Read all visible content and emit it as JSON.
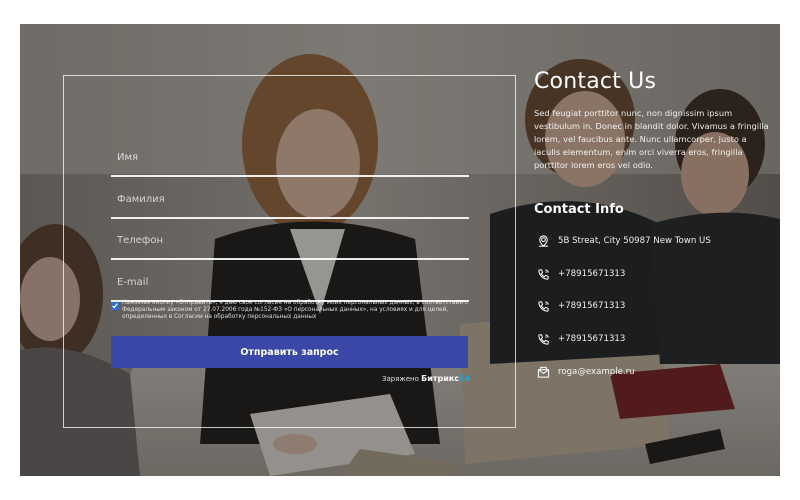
{
  "form": {
    "fields": [
      {
        "placeholder": "Имя",
        "value": ""
      },
      {
        "placeholder": "Фамилия",
        "value": ""
      },
      {
        "placeholder": "Телефон",
        "value": ""
      },
      {
        "placeholder": "E-mail",
        "value": ""
      }
    ],
    "consent_checked": true,
    "consent_text": "Нажимая кнопку «Отправить», я даю свое согласие на обработку моих персональных данных, в соответствии с Федеральным законом от 27.07.2006 года №152-ФЗ «О персональных данных», на условиях и для целей, определенных в Согласии на обработку персональных данных",
    "submit_label": "Отправить запрос",
    "powered_prefix": "Заряжено",
    "powered_brand": "Битрикс",
    "powered_brand_accent": "24"
  },
  "contact": {
    "title": "Contact Us",
    "description": "Sed feugiat porttitor nunc, non dignissim ipsum vestibulum in. Donec in blandit dolor. Vivamus a fringilla lorem, vel faucibus ante. Nunc ullamcorper, justo a iaculis elementum, enim orci viverra eros, fringilla porttitor lorem eros vel odio.",
    "info_title": "Contact Info",
    "items": [
      {
        "icon": "location-pin-icon",
        "text": "5B Streat, City 50987 New Town US"
      },
      {
        "icon": "phone-icon",
        "text": "+78915671313"
      },
      {
        "icon": "phone-icon",
        "text": "+78915671313"
      },
      {
        "icon": "phone-icon",
        "text": "+78915671313"
      },
      {
        "icon": "mail-icon",
        "text": "roga@example.ru"
      }
    ]
  },
  "colors": {
    "button": "#3b47a7",
    "brand_accent": "#1ea5d8",
    "overlay": "rgba(24,22,20,0.42)"
  }
}
